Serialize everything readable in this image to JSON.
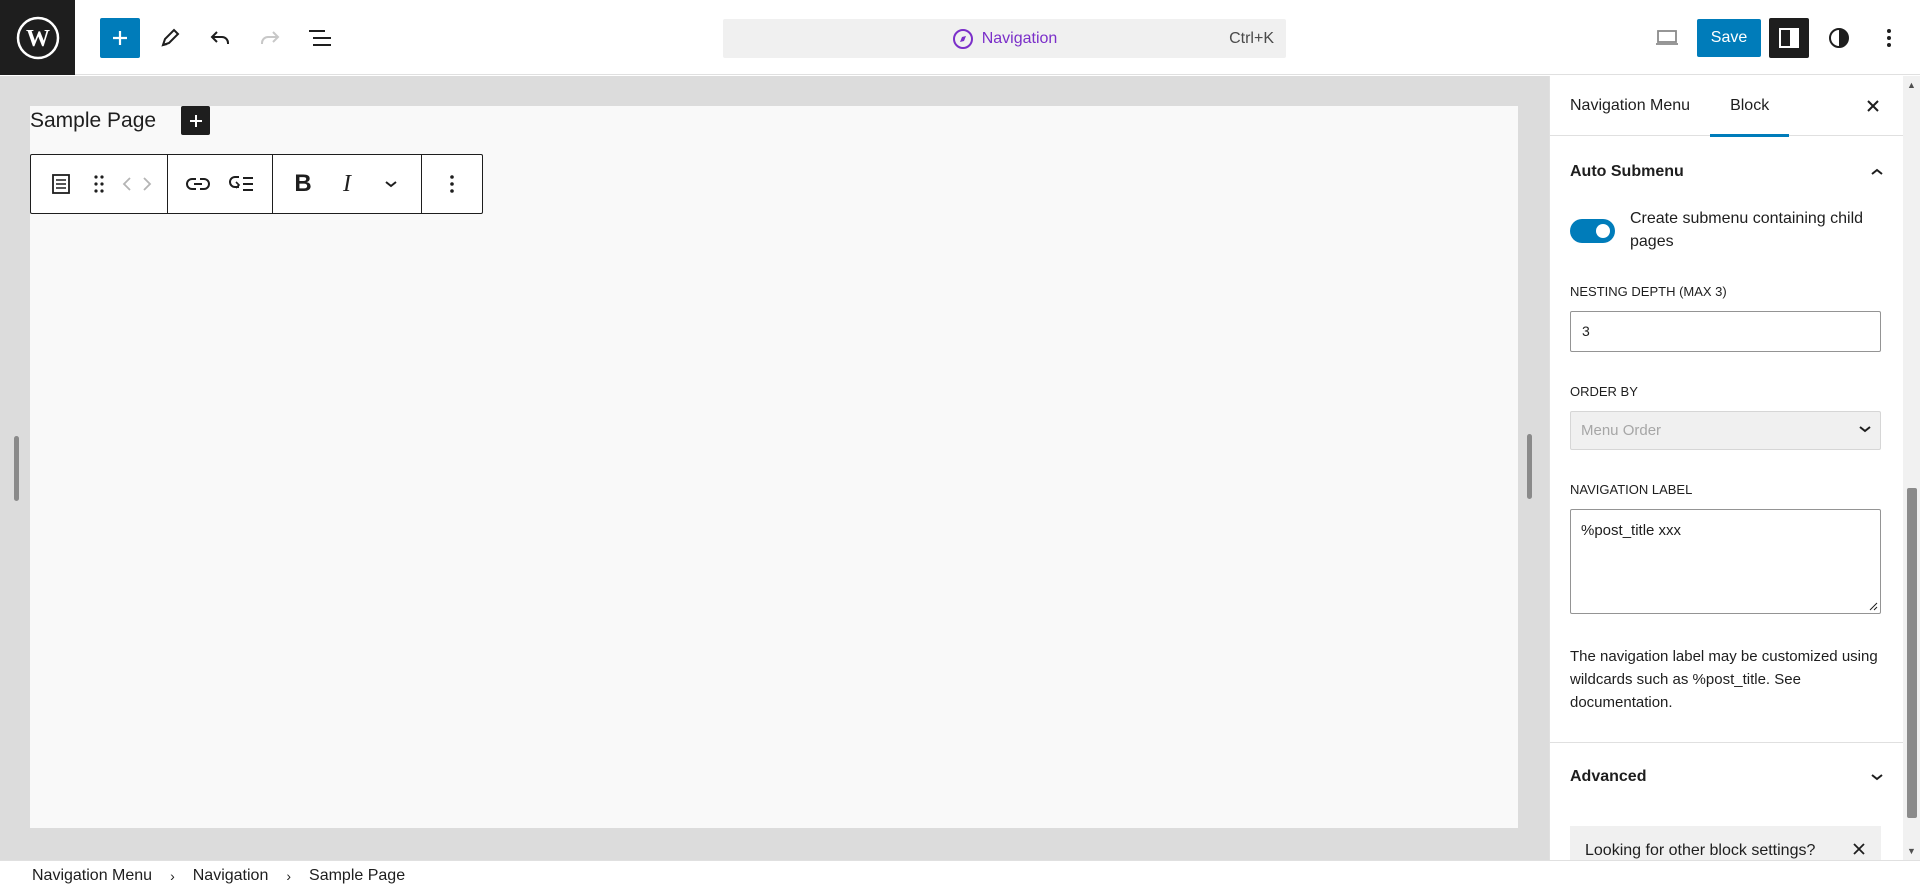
{
  "header": {
    "command_bar": {
      "label": "Navigation",
      "shortcut": "Ctrl+K"
    },
    "save_label": "Save"
  },
  "editor": {
    "page_title": "Sample Page"
  },
  "sidebar": {
    "tabs": [
      {
        "label": "Navigation Menu",
        "active": false
      },
      {
        "label": "Block",
        "active": true
      }
    ],
    "auto_submenu": {
      "title": "Auto Submenu",
      "toggle_label": "Create submenu containing child pages",
      "toggle_on": true,
      "nesting_label": "NESTING DEPTH (MAX 3)",
      "nesting_value": "3",
      "order_label": "ORDER BY",
      "order_value": "Menu Order",
      "nav_label_title": "NAVIGATION LABEL",
      "nav_label_value": "%post_title xxx",
      "help_text": "The navigation label may be customized using wildcards such as %post_title. See documentation."
    },
    "advanced_title": "Advanced",
    "notice_text": "Looking for other block settings?"
  },
  "footer": {
    "breadcrumbs": [
      "Navigation Menu",
      "Navigation",
      "Sample Page"
    ]
  },
  "colors": {
    "accent": "#007cba",
    "dark": "#1e1e1e",
    "command_purple": "#7b2fc9"
  }
}
